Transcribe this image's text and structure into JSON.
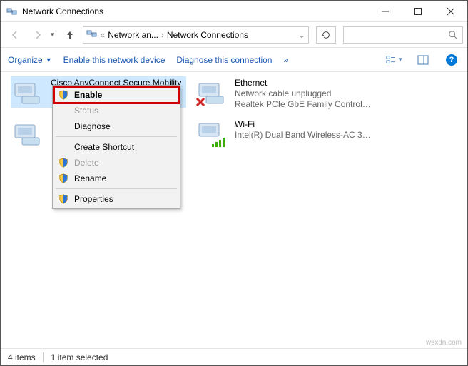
{
  "titlebar": {
    "title": "Network Connections"
  },
  "address": {
    "seg1": "Network an...",
    "seg2": "Network Connections"
  },
  "cmdbar": {
    "organize": "Organize",
    "enable": "Enable this network device",
    "diagnose": "Diagnose this connection",
    "overflow": "»"
  },
  "adapters": {
    "a0": {
      "name": "Cisco AnyConnect Secure Mobility"
    },
    "a1": {
      "name": "Ethernet",
      "sub1": "Network cable unplugged",
      "sub2": "Realtek PCIe GbE Family Controller"
    },
    "a2": {
      "name": "Wi-Fi",
      "sub1": "",
      "sub2": "Intel(R) Dual Band Wireless-AC 31..."
    }
  },
  "ctx": {
    "enable": "Enable",
    "status": "Status",
    "diagnose": "Diagnose",
    "create_shortcut": "Create Shortcut",
    "delete": "Delete",
    "rename": "Rename",
    "properties": "Properties"
  },
  "status": {
    "count": "4 items",
    "selection": "1 item selected"
  },
  "watermark": "wsxdn.com"
}
